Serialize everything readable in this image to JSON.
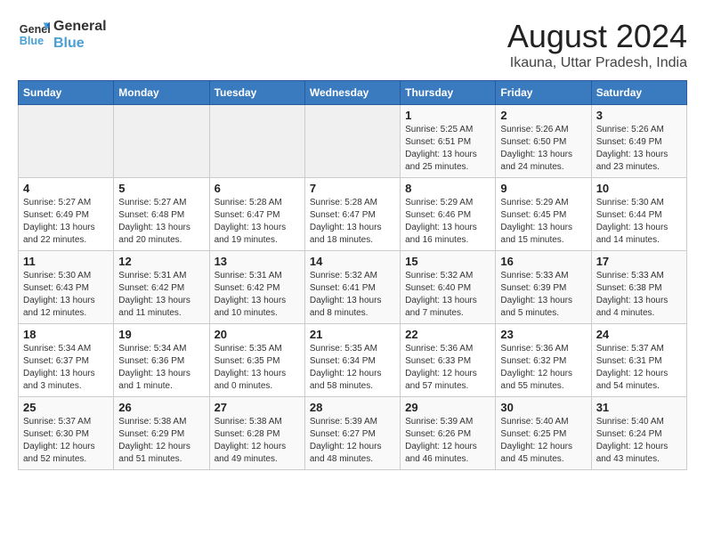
{
  "header": {
    "logo_line1": "General",
    "logo_line2": "Blue",
    "title": "August 2024",
    "subtitle": "Ikauna, Uttar Pradesh, India"
  },
  "calendar": {
    "days_of_week": [
      "Sunday",
      "Monday",
      "Tuesday",
      "Wednesday",
      "Thursday",
      "Friday",
      "Saturday"
    ],
    "weeks": [
      [
        {
          "day": "",
          "info": ""
        },
        {
          "day": "",
          "info": ""
        },
        {
          "day": "",
          "info": ""
        },
        {
          "day": "",
          "info": ""
        },
        {
          "day": "1",
          "info": "Sunrise: 5:25 AM\nSunset: 6:51 PM\nDaylight: 13 hours and 25 minutes."
        },
        {
          "day": "2",
          "info": "Sunrise: 5:26 AM\nSunset: 6:50 PM\nDaylight: 13 hours and 24 minutes."
        },
        {
          "day": "3",
          "info": "Sunrise: 5:26 AM\nSunset: 6:49 PM\nDaylight: 13 hours and 23 minutes."
        }
      ],
      [
        {
          "day": "4",
          "info": "Sunrise: 5:27 AM\nSunset: 6:49 PM\nDaylight: 13 hours and 22 minutes."
        },
        {
          "day": "5",
          "info": "Sunrise: 5:27 AM\nSunset: 6:48 PM\nDaylight: 13 hours and 20 minutes."
        },
        {
          "day": "6",
          "info": "Sunrise: 5:28 AM\nSunset: 6:47 PM\nDaylight: 13 hours and 19 minutes."
        },
        {
          "day": "7",
          "info": "Sunrise: 5:28 AM\nSunset: 6:47 PM\nDaylight: 13 hours and 18 minutes."
        },
        {
          "day": "8",
          "info": "Sunrise: 5:29 AM\nSunset: 6:46 PM\nDaylight: 13 hours and 16 minutes."
        },
        {
          "day": "9",
          "info": "Sunrise: 5:29 AM\nSunset: 6:45 PM\nDaylight: 13 hours and 15 minutes."
        },
        {
          "day": "10",
          "info": "Sunrise: 5:30 AM\nSunset: 6:44 PM\nDaylight: 13 hours and 14 minutes."
        }
      ],
      [
        {
          "day": "11",
          "info": "Sunrise: 5:30 AM\nSunset: 6:43 PM\nDaylight: 13 hours and 12 minutes."
        },
        {
          "day": "12",
          "info": "Sunrise: 5:31 AM\nSunset: 6:42 PM\nDaylight: 13 hours and 11 minutes."
        },
        {
          "day": "13",
          "info": "Sunrise: 5:31 AM\nSunset: 6:42 PM\nDaylight: 13 hours and 10 minutes."
        },
        {
          "day": "14",
          "info": "Sunrise: 5:32 AM\nSunset: 6:41 PM\nDaylight: 13 hours and 8 minutes."
        },
        {
          "day": "15",
          "info": "Sunrise: 5:32 AM\nSunset: 6:40 PM\nDaylight: 13 hours and 7 minutes."
        },
        {
          "day": "16",
          "info": "Sunrise: 5:33 AM\nSunset: 6:39 PM\nDaylight: 13 hours and 5 minutes."
        },
        {
          "day": "17",
          "info": "Sunrise: 5:33 AM\nSunset: 6:38 PM\nDaylight: 13 hours and 4 minutes."
        }
      ],
      [
        {
          "day": "18",
          "info": "Sunrise: 5:34 AM\nSunset: 6:37 PM\nDaylight: 13 hours and 3 minutes."
        },
        {
          "day": "19",
          "info": "Sunrise: 5:34 AM\nSunset: 6:36 PM\nDaylight: 13 hours and 1 minute."
        },
        {
          "day": "20",
          "info": "Sunrise: 5:35 AM\nSunset: 6:35 PM\nDaylight: 13 hours and 0 minutes."
        },
        {
          "day": "21",
          "info": "Sunrise: 5:35 AM\nSunset: 6:34 PM\nDaylight: 12 hours and 58 minutes."
        },
        {
          "day": "22",
          "info": "Sunrise: 5:36 AM\nSunset: 6:33 PM\nDaylight: 12 hours and 57 minutes."
        },
        {
          "day": "23",
          "info": "Sunrise: 5:36 AM\nSunset: 6:32 PM\nDaylight: 12 hours and 55 minutes."
        },
        {
          "day": "24",
          "info": "Sunrise: 5:37 AM\nSunset: 6:31 PM\nDaylight: 12 hours and 54 minutes."
        }
      ],
      [
        {
          "day": "25",
          "info": "Sunrise: 5:37 AM\nSunset: 6:30 PM\nDaylight: 12 hours and 52 minutes."
        },
        {
          "day": "26",
          "info": "Sunrise: 5:38 AM\nSunset: 6:29 PM\nDaylight: 12 hours and 51 minutes."
        },
        {
          "day": "27",
          "info": "Sunrise: 5:38 AM\nSunset: 6:28 PM\nDaylight: 12 hours and 49 minutes."
        },
        {
          "day": "28",
          "info": "Sunrise: 5:39 AM\nSunset: 6:27 PM\nDaylight: 12 hours and 48 minutes."
        },
        {
          "day": "29",
          "info": "Sunrise: 5:39 AM\nSunset: 6:26 PM\nDaylight: 12 hours and 46 minutes."
        },
        {
          "day": "30",
          "info": "Sunrise: 5:40 AM\nSunset: 6:25 PM\nDaylight: 12 hours and 45 minutes."
        },
        {
          "day": "31",
          "info": "Sunrise: 5:40 AM\nSunset: 6:24 PM\nDaylight: 12 hours and 43 minutes."
        }
      ]
    ]
  }
}
